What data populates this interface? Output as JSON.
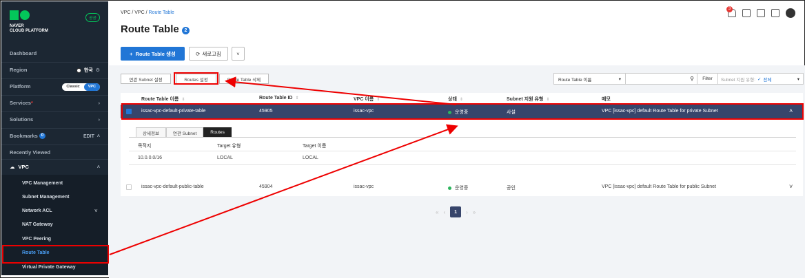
{
  "sidebar": {
    "logo_text_line1": "NAVER",
    "logo_text_line2": "CLOUD PLATFORM",
    "gov_badge": "공공",
    "dashboard": "Dashboard",
    "region": "Region",
    "region_value": "한국",
    "platform": "Platform",
    "platform_options": [
      "Classic",
      "VPC"
    ],
    "services": "Services",
    "solutions": "Solutions",
    "bookmarks": "Bookmarks",
    "bookmarks_count": "0",
    "bookmarks_edit": "EDIT",
    "recently_viewed": "Recently Viewed",
    "vpc_group": "VPC",
    "sub_items": [
      "VPC Management",
      "Subnet Management",
      "Network ACL",
      "NAT Gateway",
      "VPC Peering",
      "Route Table",
      "Virtual Private Gateway"
    ]
  },
  "breadcrumb": {
    "a": "VPC",
    "sep1": "/",
    "b": "VPC",
    "sep2": "/",
    "current": "Route Table"
  },
  "page": {
    "title": "Route Table",
    "help_count": "2"
  },
  "header": {
    "notification_count": "3"
  },
  "actions": {
    "create": "Route Table 생성",
    "refresh": "새로고침"
  },
  "toolbar": {
    "subnet_setting": "연관 Subnet 설정",
    "routes_setting": "Routes 설정",
    "delete": "Route Table 삭제",
    "search_select": "Route Table 이름",
    "filter": "Filter",
    "subnet_type_label": "Subnet 지원 유형:",
    "subnet_type_value": "전체"
  },
  "table": {
    "columns": [
      "Route Table 이름",
      "Route Table ID",
      "VPC 이름",
      "상태",
      "Subnet 지원 유형",
      "메모"
    ],
    "rows": [
      {
        "name": "issac-vpc-default-private-table",
        "id": "45905",
        "vpc": "issac-vpc",
        "status": "운영중",
        "subnet_type": "사설",
        "memo": "VPC [issac-vpc] default Route Table for private Subnet"
      },
      {
        "name": "issac-vpc-default-public-table",
        "id": "45904",
        "vpc": "issac-vpc",
        "status": "운영중",
        "subnet_type": "공인",
        "memo": "VPC [issac-vpc] default Route Table for public Subnet"
      }
    ]
  },
  "detail": {
    "tabs": [
      "상세정보",
      "연관 Subnet",
      "Routes"
    ],
    "columns": [
      "목적지",
      "Target 유형",
      "Target 이름"
    ],
    "route": {
      "destination": "10.0.0.0/16",
      "target_type": "LOCAL",
      "target_name": "LOCAL"
    }
  },
  "pager": {
    "current": "1"
  },
  "colors": {
    "accent": "#2176d6",
    "selected_row": "#37456b",
    "highlight": "#ee0000",
    "status_ok": "#2db55d"
  }
}
